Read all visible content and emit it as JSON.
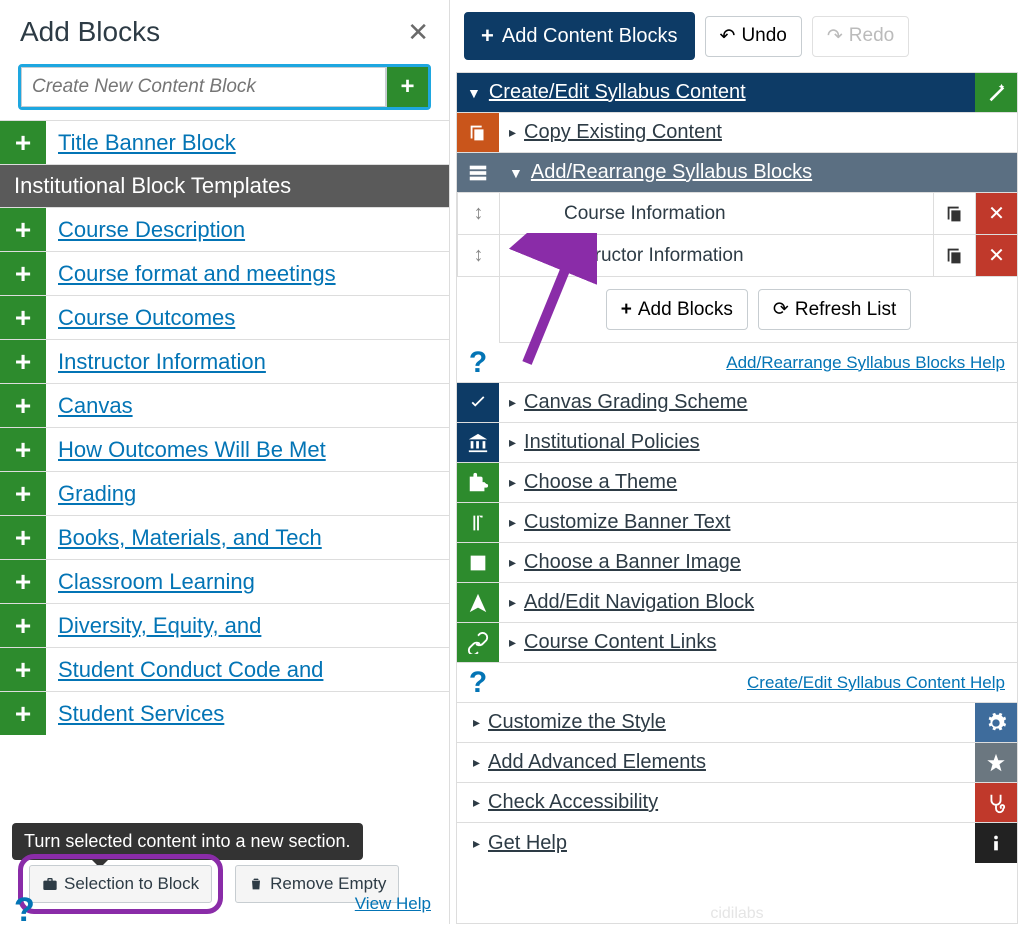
{
  "left": {
    "title": "Add Blocks",
    "input_placeholder": "Create New Content Block",
    "title_banner": "Title Banner Block",
    "templates_header": "Institutional Block Templates",
    "templates": [
      "Course Description",
      "Course format and meetings",
      "Course Outcomes",
      "Instructor Information",
      "Canvas",
      "How Outcomes Will Be Met",
      "Grading",
      "Books, Materials, and Tech",
      "Classroom Learning",
      "Diversity, Equity, and",
      "Student Conduct Code and",
      "Student Services"
    ],
    "tooltip": "Turn selected content into a new section.",
    "selection_btn": "Selection to Block",
    "remove_btn": "Remove Empty",
    "view_help": "View Help"
  },
  "right": {
    "add_content": "Add Content Blocks",
    "undo": "Undo",
    "redo": "Redo",
    "create_edit": "Create/Edit Syllabus Content",
    "copy_existing": "Copy Existing Content",
    "add_rearrange": "Add/Rearrange Syllabus Blocks",
    "course_info": "Course Information",
    "instructor_info": "Instructor Information",
    "add_blocks_btn": "Add Blocks",
    "refresh_btn": "Refresh List",
    "rearrange_help": "Add/Rearrange Syllabus Blocks Help",
    "canvas_grading": "Canvas Grading Scheme",
    "institutional": "Institutional Policies",
    "choose_theme": "Choose a Theme",
    "banner_text": "Customize Banner Text",
    "banner_image": "Choose a Banner Image",
    "nav_block": "Add/Edit Navigation Block",
    "content_links": "Course Content Links",
    "create_help": "Create/Edit Syllabus Content Help",
    "customize_style": "Customize the Style",
    "advanced": "Add Advanced Elements",
    "accessibility": "Check Accessibility",
    "get_help": "Get Help",
    "watermark": "cidilabs"
  }
}
